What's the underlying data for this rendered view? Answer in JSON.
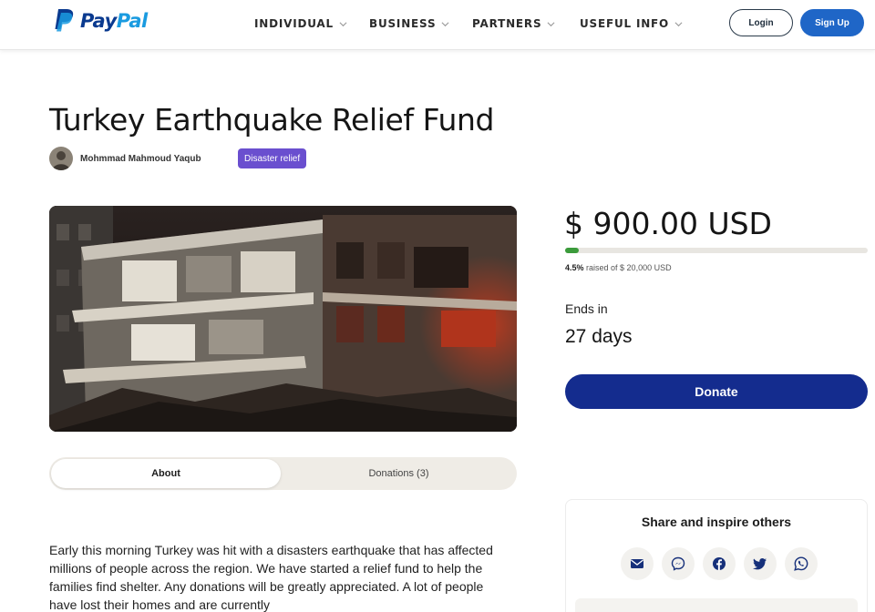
{
  "brand": {
    "name_part1": "Pay",
    "name_part2": "Pal"
  },
  "nav": [
    {
      "label": "INDIVIDUAL"
    },
    {
      "label": "BUSINESS"
    },
    {
      "label": "PARTNERS"
    },
    {
      "label": "USEFUL INFO"
    }
  ],
  "auth": {
    "login": "Login",
    "signup": "Sign Up"
  },
  "campaign": {
    "title": "Turkey Earthquake Relief Fund",
    "author": "Mohmmad Mahmoud Yaqub",
    "tag": "Disaster relief",
    "amount": "$ 900.00 USD",
    "progress_fraction": 0.045,
    "progress_percent": "4.5%",
    "raised_text": "raised of $ 20,000 USD",
    "ends_label": "Ends in",
    "ends_value": "27 days",
    "donate_label": "Donate"
  },
  "tabs": {
    "about": "About",
    "donations": "Donations (3)"
  },
  "about_text": "Early this morning Turkey was hit with a disasters earthquake that has affected millions of people across the region. We have started a relief fund to help the families find shelter. Any donations will be greatly appreciated. A lot of people have lost their homes and are currently",
  "share": {
    "title": "Share and inspire others",
    "icons": [
      "email-icon",
      "messenger-icon",
      "facebook-icon",
      "twitter-icon",
      "whatsapp-icon"
    ]
  },
  "colors": {
    "brand_dark": "#0a3a8f",
    "brand_light": "#1a9be0",
    "donate": "#142c8e",
    "tag": "#6a4fcf",
    "progress": "#3b9b3b"
  }
}
